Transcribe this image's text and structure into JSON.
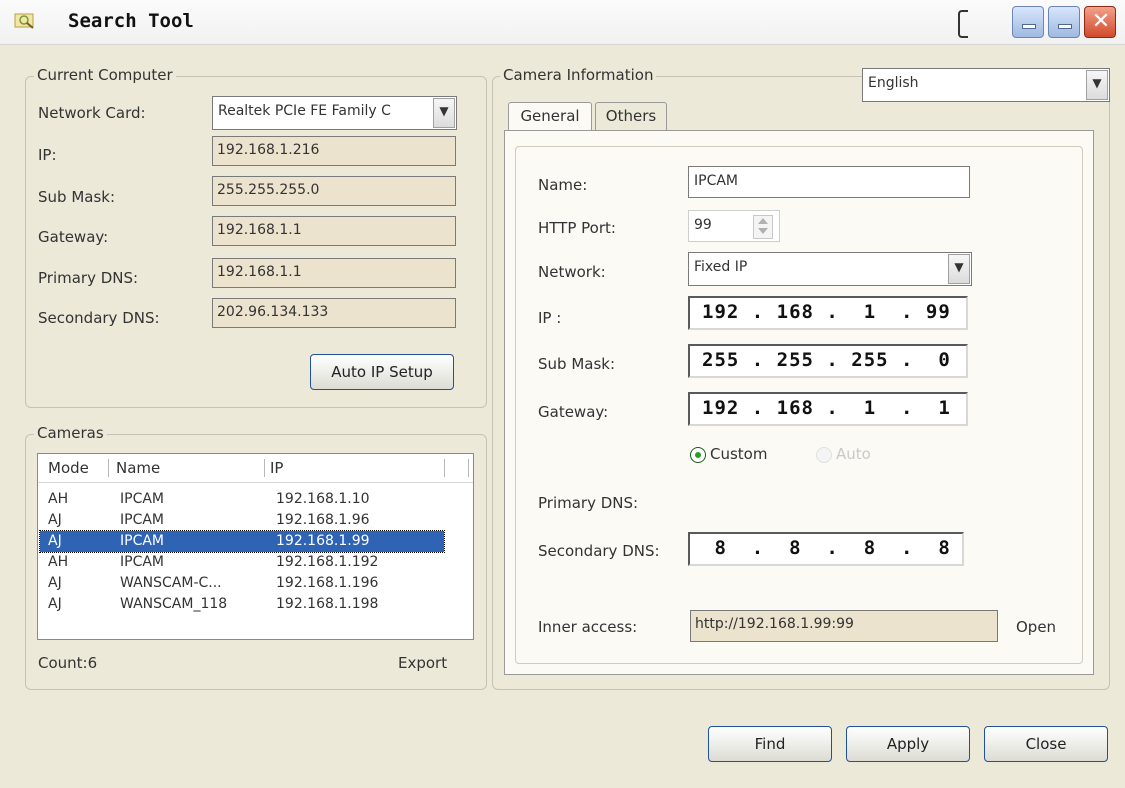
{
  "window": {
    "title": "Search Tool"
  },
  "current_computer": {
    "label": "Current Computer",
    "network_card_label": "Network Card:",
    "network_card_value": "Realtek PCIe FE Family C",
    "ip_label": "IP:",
    "ip_value": "192.168.1.216",
    "submask_label": "Sub Mask:",
    "submask_value": "255.255.255.0",
    "gateway_label": "Gateway:",
    "gateway_value": "192.168.1.1",
    "primary_dns_label": "Primary DNS:",
    "primary_dns_value": "192.168.1.1",
    "secondary_dns_label": "Secondary DNS:",
    "secondary_dns_value": "202.96.134.133",
    "auto_ip_button": "Auto IP Setup"
  },
  "cameras": {
    "label": "Cameras",
    "columns": [
      "Mode",
      "Name",
      "IP"
    ],
    "rows": [
      [
        "AH",
        "IPCAM",
        "192.168.1.10"
      ],
      [
        "AJ",
        "IPCAM",
        "192.168.1.96"
      ],
      [
        "AJ",
        "IPCAM",
        "192.168.1.99"
      ],
      [
        "AH",
        "IPCAM",
        "192.168.1.192"
      ],
      [
        "AJ",
        "WANSCAM-C...",
        "192.168.1.196"
      ],
      [
        "AJ",
        "WANSCAM_118",
        "192.168.1.198"
      ]
    ],
    "selected_index": 2,
    "count_text": "Count:6",
    "export_label": "Export"
  },
  "camera_info": {
    "label": "Camera Information",
    "language": "English",
    "tabs": [
      "General",
      "Others"
    ],
    "name_label": "Name:",
    "name_value": "IPCAM",
    "http_port_label": "HTTP Port:",
    "http_port_value": "99",
    "network_label": "Network:",
    "network_value": "Fixed IP",
    "ip_label": "IP :",
    "ip_value": "192 . 168 .  1  . 99",
    "submask_label": "Sub Mask:",
    "submask_value": "255 . 255 . 255 .  0",
    "gateway_label": "Gateway:",
    "gateway_value": "192 . 168 .  1  .  1",
    "custom_label": "Custom",
    "auto_label": "Auto",
    "primary_dns_label": "Primary DNS:",
    "secondary_dns_label": "Secondary DNS:",
    "secondary_dns_value": " 8  .  8  .  8  .  8",
    "inner_access_label": "Inner access:",
    "inner_access_value": "http://192.168.1.99:99",
    "open_label": "Open"
  },
  "buttons": {
    "find": "Find",
    "apply": "Apply",
    "close": "Close"
  }
}
